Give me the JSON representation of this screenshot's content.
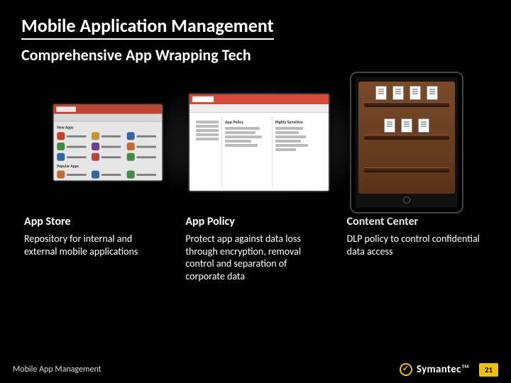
{
  "title": "Mobile Application Management",
  "subtitle": "Comprehensive App Wrapping Tech",
  "columns": [
    {
      "heading": "App Store",
      "body": "Repository for internal and external mobile applications"
    },
    {
      "heading": "App Policy",
      "body": "Protect app against data loss through encryption, removal control and separation of corporate data"
    },
    {
      "heading": "Content Center",
      "body": "DLP policy to control confidential data access"
    }
  ],
  "footer": {
    "left": "Mobile App Management",
    "brand": "Symantec",
    "tm": "TM",
    "page": "21"
  }
}
